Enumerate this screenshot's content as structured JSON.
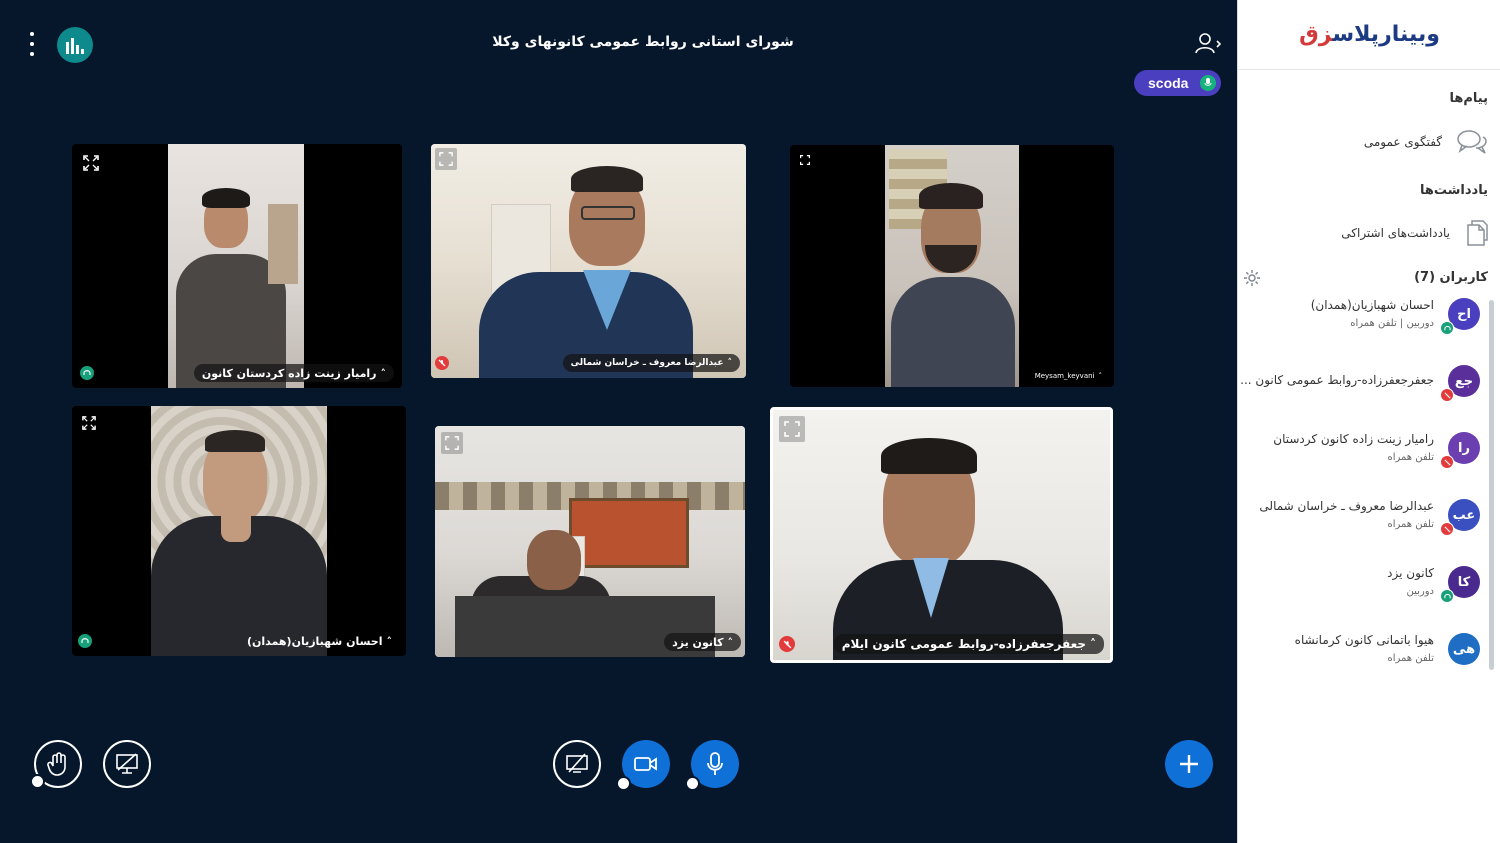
{
  "header": {
    "meeting_title": "شورای استانی روابط عمومی کانونهای وکلا",
    "presenter_name": "scoda"
  },
  "tiles": [
    {
      "name": "رامیار زینت زاده کردستان کانون",
      "status": "listen"
    },
    {
      "name": "عبدالرضا معروف ـ خراسان شمالی",
      "status": "muted"
    },
    {
      "name": "Meysam_keyvani",
      "status": "none"
    },
    {
      "name": "احسان شهبازیان(همدان)",
      "status": "listen"
    },
    {
      "name": "کانون یزد",
      "status": "none"
    },
    {
      "name": "جعفرجعفرزاده-روابط عمومی کانون ایلام",
      "status": "muted"
    }
  ],
  "sidebar": {
    "brand": {
      "main": "وبینارپلاس",
      "accent": "زق"
    },
    "messages_heading": "پیام‌ها",
    "public_chat_label": "گفتگوی عمومی",
    "notes_heading": "یادداشت‌ها",
    "shared_notes_label": "یادداشت‌های اشتراکی",
    "users_heading": "کاربران (7)",
    "users": [
      {
        "initials": "اح",
        "name": "احسان شهبازیان(همدان)",
        "meta": "دوربین | تلفن همراه",
        "avatar_color": "#4a3fbf",
        "status": "listen"
      },
      {
        "initials": "جع",
        "name": "جعفرجعفرزاده-روابط عمومی کانون ...",
        "meta": "",
        "avatar_color": "#5a2f9a",
        "status": "muted"
      },
      {
        "initials": "را",
        "name": "رامیار زینت زاده کانون کردستان",
        "meta": "تلفن همراه",
        "avatar_color": "#6b3fb0",
        "status": "muted"
      },
      {
        "initials": "عب",
        "name": "عبدالرضا معروف ـ خراسان شمالی",
        "meta": "تلفن همراه",
        "avatar_color": "#3a4fc0",
        "status": "muted"
      },
      {
        "initials": "کا",
        "name": "کانون یزد",
        "meta": "دوربین",
        "avatar_color": "#4b2a8f",
        "status": "listen"
      },
      {
        "initials": "هی",
        "name": "هیوا باتمانی کانون کرمانشاه",
        "meta": "تلفن همراه",
        "avatar_color": "#1f6ec4",
        "status": "none"
      }
    ]
  },
  "colors": {
    "stage_bg": "#06172c",
    "accent_blue": "#0f70d7",
    "presenter_pill": "#4a3fbf",
    "listen_green": "#17a07a",
    "muted_red": "#e33b3b"
  }
}
